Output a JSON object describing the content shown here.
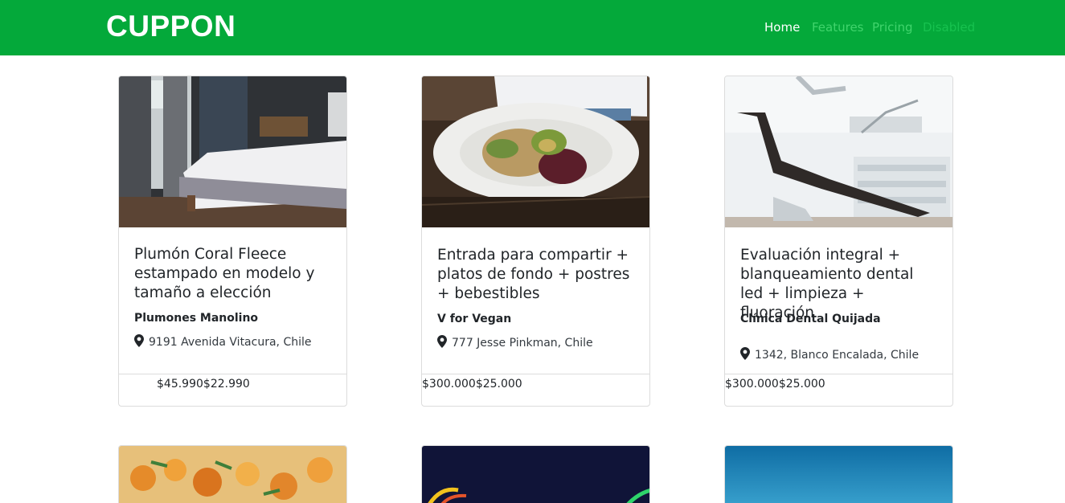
{
  "navbar": {
    "brand": "CUPPON",
    "links": [
      {
        "label": "Home"
      },
      {
        "label": "Features"
      },
      {
        "label": "Pricing"
      },
      {
        "label": "Disabled"
      }
    ]
  },
  "deals": [
    {
      "title": "Plumón Coral Fleece estampado en modelo y tamaño a elección",
      "company": "Plumones Manolino",
      "location": "9191 Avenida Vitacura, Chile",
      "original_price": "$45.990",
      "price": "$22.990"
    },
    {
      "title": "Entrada para compartir + platos de fondo + postres + bebestibles",
      "company": "V for Vegan",
      "location": "777 Jesse Pinkman, Chile",
      "original_price": "$300.000",
      "price": "$25.000"
    },
    {
      "title": "Evaluación integral + blanqueamiento dental led + limpieza + fluoración",
      "company": "Clínica Dental Quijada",
      "location": "1342, Blanco Encalada, Chile",
      "original_price": "$300.000",
      "price": "$25.000"
    }
  ],
  "icons": {
    "location": "map-marker-icon"
  },
  "colors": {
    "navbar": "#04a93a",
    "nav_active": "#ffffff",
    "nav_inactive": "#40d46c"
  }
}
